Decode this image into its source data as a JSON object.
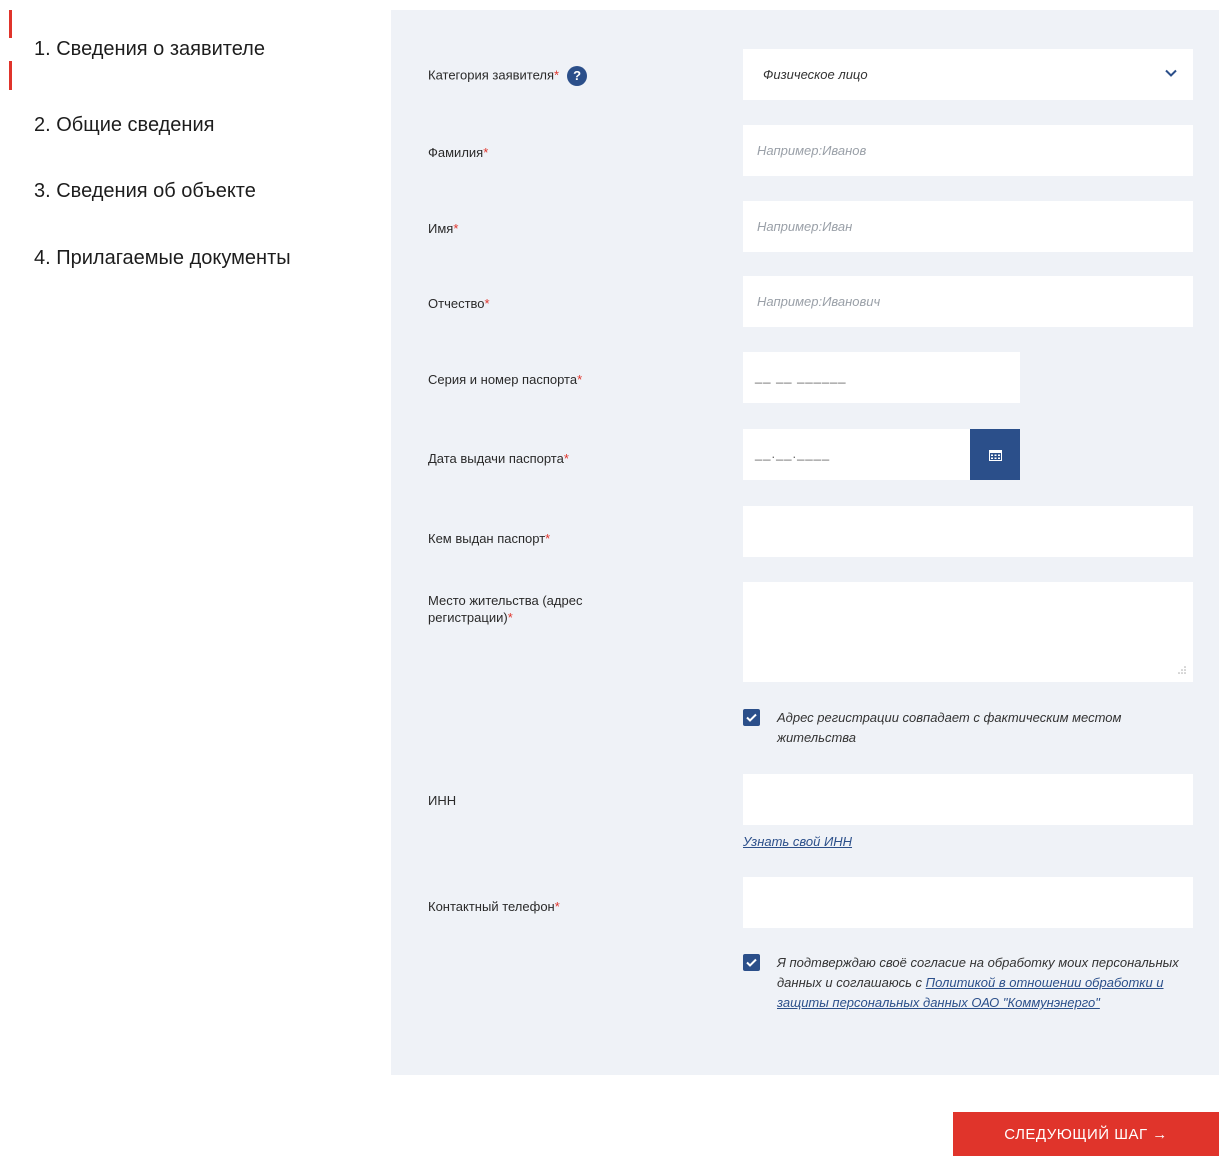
{
  "steps": [
    {
      "label": "1. Сведения о заявителе"
    },
    {
      "label": "2. Общие сведения"
    },
    {
      "label": "3. Сведения об объекте"
    },
    {
      "label": "4. Прилагаемые документы"
    }
  ],
  "form": {
    "category_label": "Категория заявителя",
    "category_value": "Физическое лицо",
    "help_glyph": "?",
    "lastname_label": "Фамилия",
    "lastname_placeholder": "Например:Иванов",
    "firstname_label": "Имя",
    "firstname_placeholder": "Например:Иван",
    "patronymic_label": "Отчество",
    "patronymic_placeholder": "Например:Иванович",
    "passport_number_label": "Серия и номер паспорта",
    "passport_number_mask": "__ __ ______",
    "passport_date_label": "Дата выдачи паспорта",
    "passport_date_mask": "__.__.____",
    "passport_issuer_label": "Кем выдан паспорт",
    "address_label": "Место жительства (адрес регистрации)",
    "address_same_text": "Адрес регистрации совпадает с фактическим местом жительства",
    "inn_label": "ИНН",
    "inn_link": "Узнать свой ИНН",
    "phone_label": "Контактный телефон",
    "consent_text": "Я подтверждаю своё согласие на обработку моих персональных данных и соглашаюсь с ",
    "consent_link": "Политикой в отношении обработки и защиты персональных данных ОАО \"Коммунэнерго\"",
    "required_mark": "*"
  },
  "actions": {
    "next_label": "СЛЕДУЮЩИЙ ШАГ →"
  },
  "colors": {
    "accent_red": "#e0342b",
    "brand_blue": "#2b4f8a",
    "panel_bg": "#eff2f7"
  }
}
